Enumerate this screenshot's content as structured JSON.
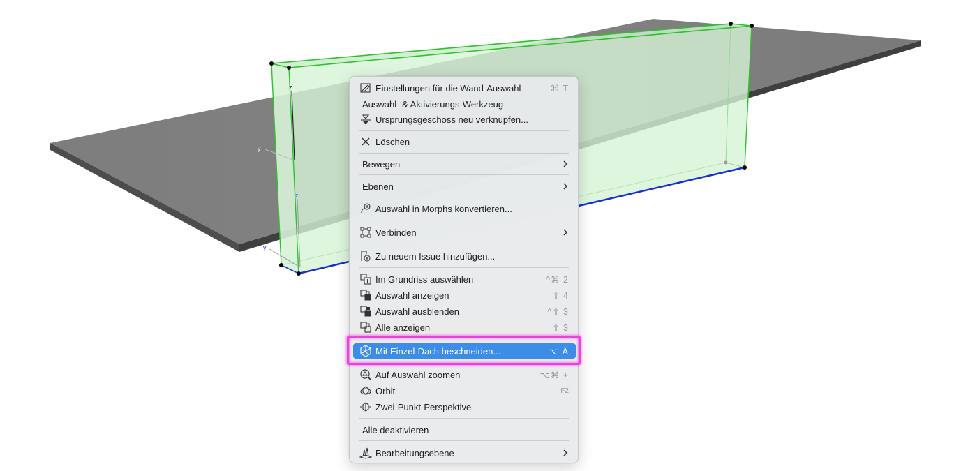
{
  "viewport": {
    "axis_labels": {
      "z1": "z",
      "y1": "y",
      "z2": "z",
      "y2": "y"
    }
  },
  "colors": {
    "slab": "#7f7f7f",
    "wall_fill": "#d6f2d6",
    "wall_edge": "#2fbf2f",
    "baseline": "#1a2fd4",
    "menu_bg": "#e8eaec",
    "highlight_bg": "#3d8ce8",
    "annotation": "#ee3fe0"
  },
  "menu": {
    "items": [
      {
        "label": "Einstellungen für die Wand-Auswahl",
        "shortcut": "⌘ T",
        "icon": "settings-pen-icon"
      },
      {
        "label": "Auswahl- & Aktivierungs-Werkzeug",
        "shortcut": "",
        "icon": ""
      },
      {
        "label": "Ursprungsgeschoss neu verknüpfen...",
        "shortcut": "",
        "icon": "story-link-icon"
      },
      {
        "label": "Löschen",
        "shortcut": "",
        "icon": "delete-x-icon"
      },
      {
        "label": "Bewegen",
        "shortcut": "",
        "icon": "",
        "submenu": true
      },
      {
        "label": "Ebenen",
        "shortcut": "",
        "icon": "",
        "submenu": true
      },
      {
        "label": "Auswahl in Morphs konvertieren...",
        "shortcut": "",
        "icon": "morph-convert-icon"
      },
      {
        "label": "Verbinden",
        "shortcut": "",
        "icon": "connect-icon",
        "submenu": true
      },
      {
        "label": "Zu neuem Issue hinzufügen...",
        "shortcut": "",
        "icon": "issue-add-icon"
      },
      {
        "label": "Im Grundriss auswählen",
        "shortcut": "^⌘ 2",
        "icon": "floorplan-select-icon"
      },
      {
        "label": "Auswahl anzeigen",
        "shortcut": "⇧ 4",
        "icon": "show-selection-icon"
      },
      {
        "label": "Auswahl ausblenden",
        "shortcut": "^⇧ 3",
        "icon": "hide-selection-icon"
      },
      {
        "label": "Alle anzeigen",
        "shortcut": "⇧ 3",
        "icon": "show-all-icon"
      },
      {
        "label": "Mit Einzel-Dach beschneiden...",
        "shortcut": "⌥ Ä",
        "icon": "roof-trim-icon",
        "highlighted": true
      },
      {
        "label": "Auf Auswahl zoomen",
        "shortcut": "⌥⌘ +",
        "icon": "zoom-selection-icon"
      },
      {
        "label": "Orbit",
        "shortcut": "F2",
        "icon": "orbit-icon"
      },
      {
        "label": "Zwei-Punkt-Perspektive",
        "shortcut": "",
        "icon": "two-point-perspective-icon"
      },
      {
        "label": "Alle deaktivieren",
        "shortcut": "",
        "icon": ""
      },
      {
        "label": "Bearbeitungsebene",
        "shortcut": "",
        "icon": "editing-plane-icon",
        "submenu": true
      }
    ]
  }
}
